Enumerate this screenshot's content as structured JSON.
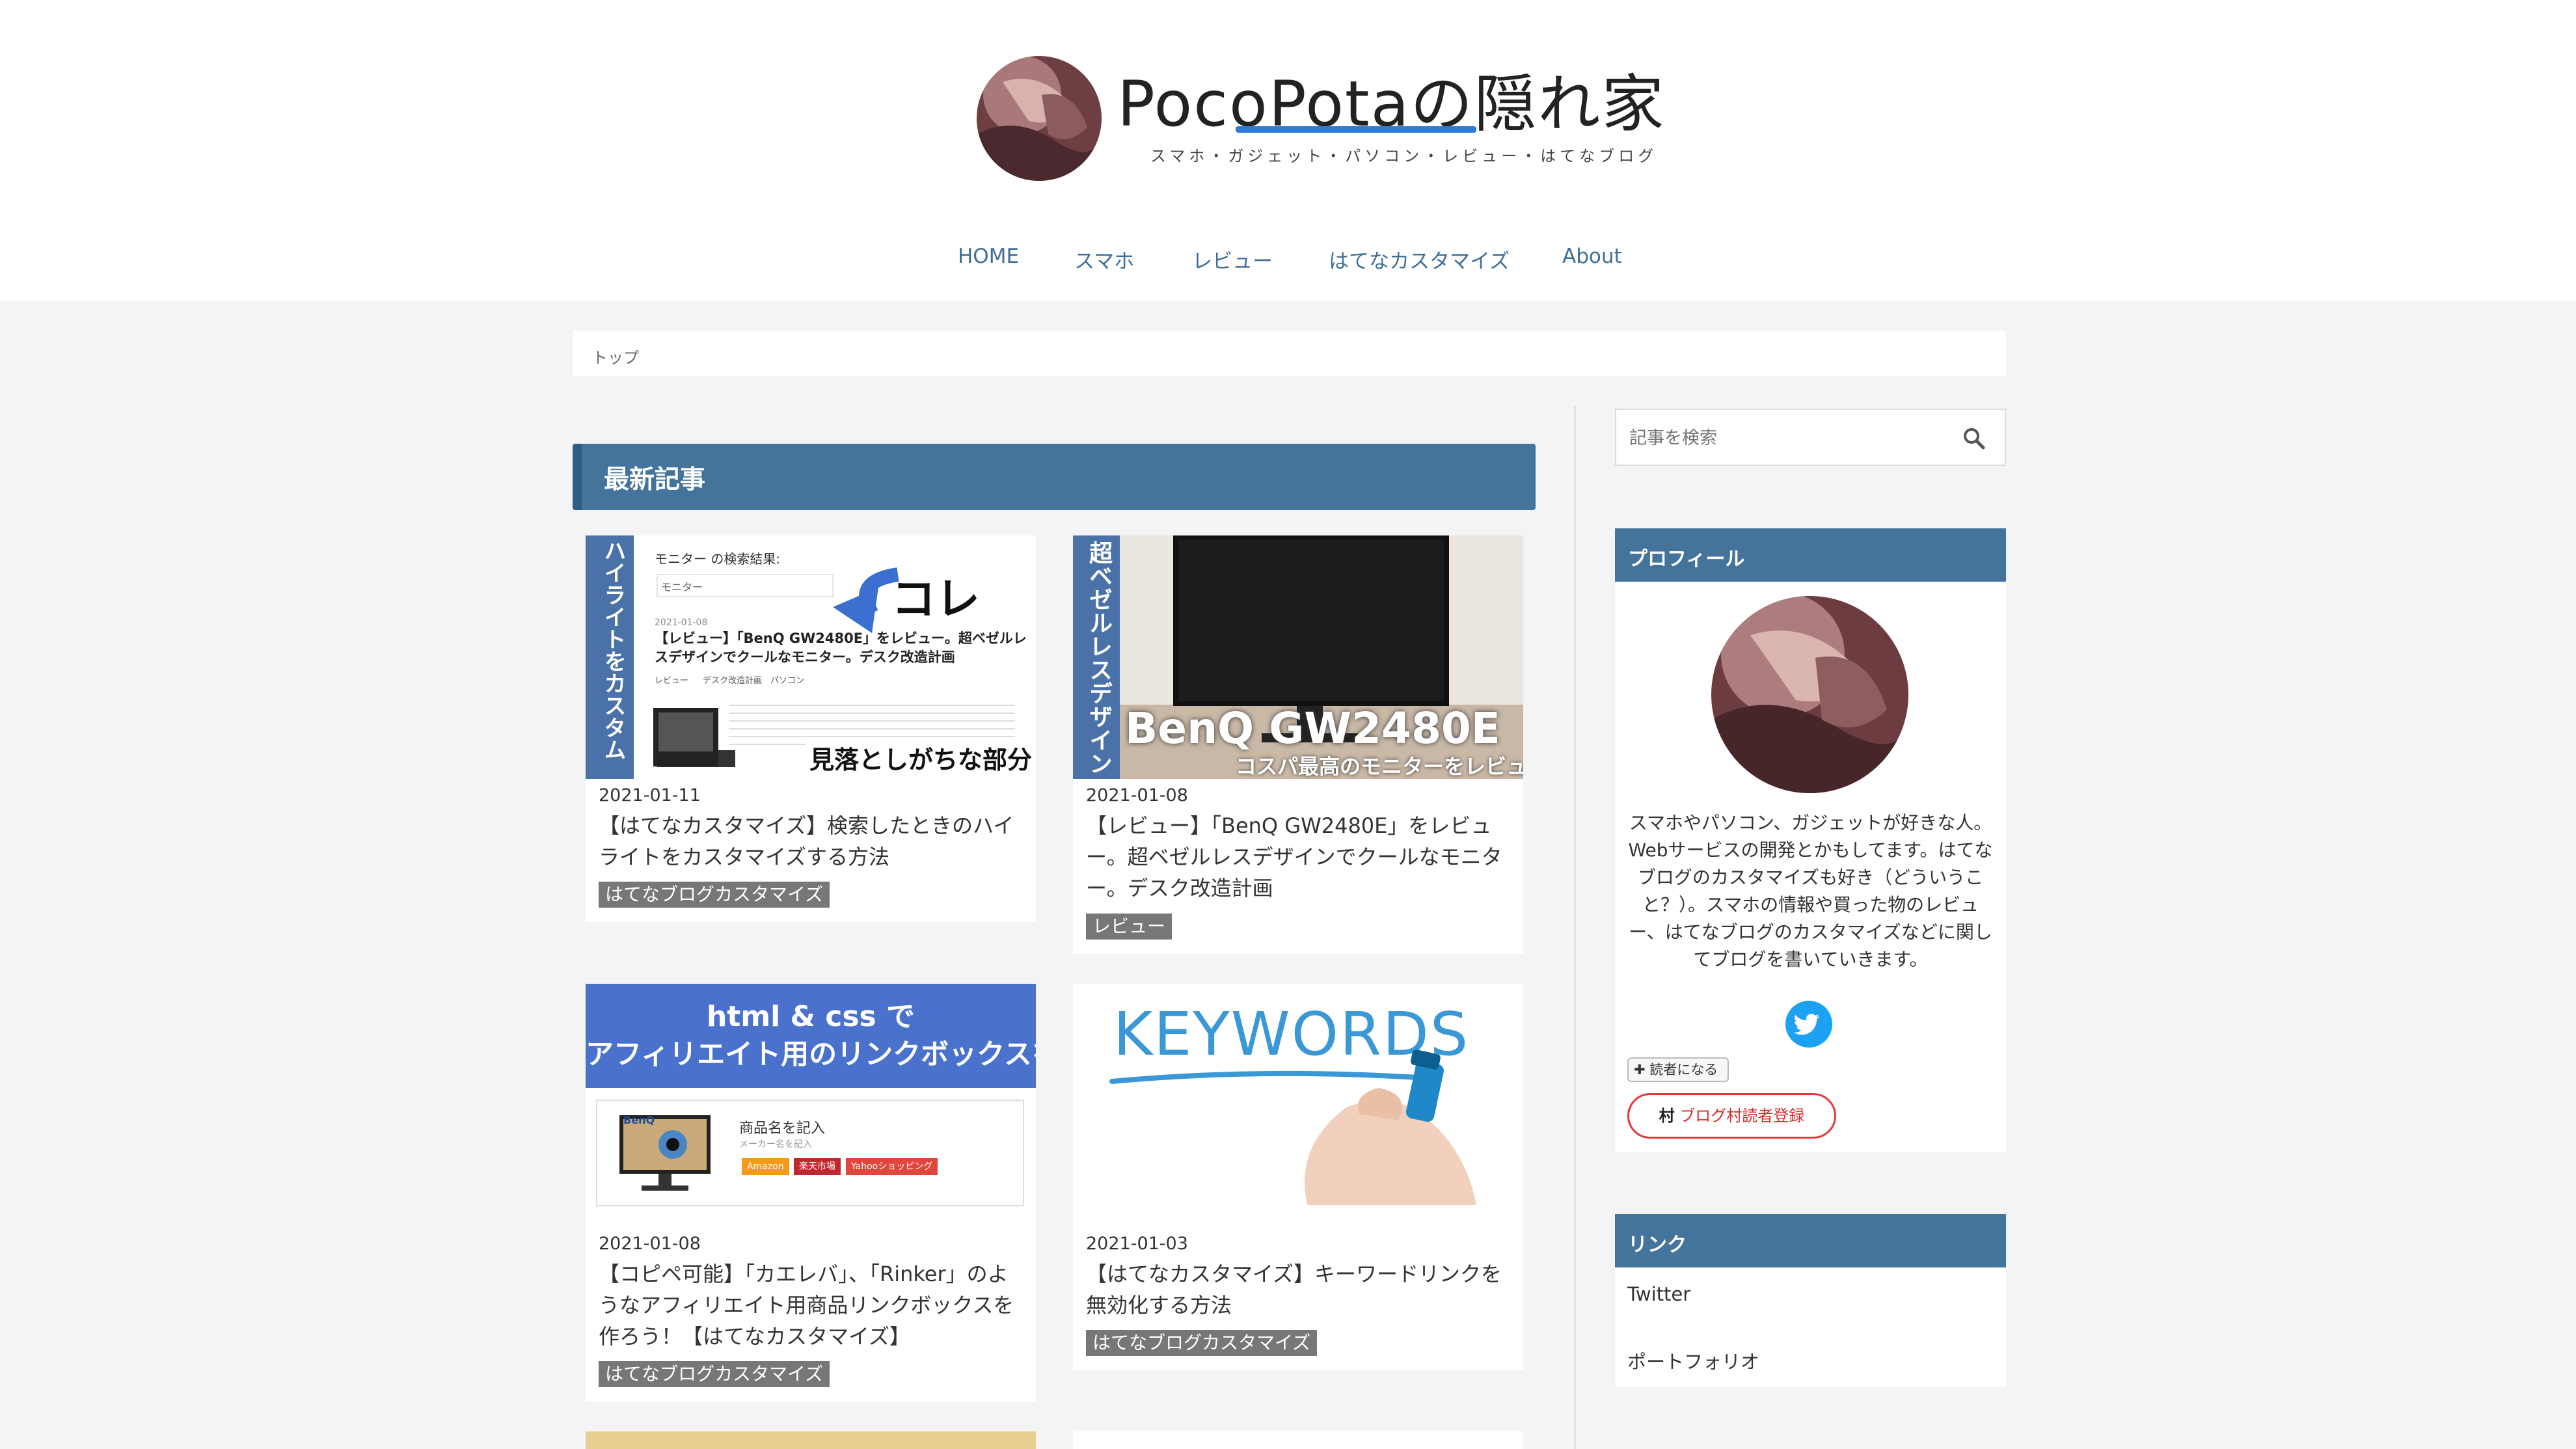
{
  "header": {
    "site_title": "PocoPotaの隠れ家",
    "tagline": "スマホ・ガジェット・パソコン・レビュー・はてなブログ",
    "nav": [
      "HOME",
      "スマホ",
      "レビュー",
      "はてなカスタマイズ",
      "About"
    ]
  },
  "breadcrumb": "トップ",
  "main": {
    "section_title": "最新記事",
    "articles": [
      {
        "date": "2021-01-11",
        "title": "【はてなカスタマイズ】検索したときのハイライトをカスタマイズする方法",
        "category": "はてなブログカスタマイズ",
        "thumb": {
          "side_label": "ハイライトをカスタム",
          "search_heading": "モニター の検索結果:",
          "search_value": "モニター",
          "callout": "コレ",
          "result_date": "2021-01-08",
          "result_title": "【レビュー】「BenQ GW2480E」をレビュー。超ベゼルレスデザインでクールなモニター。デスク改造計画",
          "result_tags": [
            "レビュー",
            "デスク改造計画",
            "パソコン"
          ],
          "caption": "見落としがちな部分"
        }
      },
      {
        "date": "2021-01-08",
        "title": "【レビュー】「BenQ GW2480E」をレビュー。超ベゼルレスデザインでクールなモニター。デスク改造計画",
        "category": "レビュー",
        "thumb": {
          "side_label": "超ベゼルレスデザイン",
          "model": "BenQ GW2480E",
          "subcaption": "コスパ最高のモニターをレビュー"
        }
      },
      {
        "date": "2021-01-08",
        "title": "【コピペ可能】「カエレバ」、「Rinker」のようなアフィリエイト用商品リンクボックスを作ろう！【はてなカスタマイズ】",
        "category": "はてなブログカスタマイズ",
        "thumb": {
          "banner_line1": "html & css で",
          "banner_line2": "アフィリエイト用のリンクボックスを",
          "brand": "BenQ",
          "product_name": "商品名を記入",
          "maker": "メーカー名を記入",
          "shop_buttons": [
            "Amazon",
            "楽天市場",
            "Yahooショッピング"
          ]
        }
      },
      {
        "date": "2021-01-03",
        "title": "【はてなカスタマイズ】キーワードリンクを無効化する方法",
        "category": "はてなブログカスタマイズ",
        "thumb": {
          "word": "KEYWORDS"
        }
      }
    ]
  },
  "sidebar": {
    "search_placeholder": "記事を検索",
    "profile_title": "プロフィール",
    "profile_text": "スマホやパソコン、ガジェットが好きな人。Webサービスの開発とかもしてます。はてなブログのカスタマイズも好き（どういうこと？）。スマホの情報や買った物のレビュー、はてなブログのカスタマイズなどに関してブログを書いていきます。",
    "follow_label": "読者になる",
    "village_label": "ブログ村読者登録",
    "links_title": "リンク",
    "links": [
      "Twitter",
      "ポートフォリオ"
    ]
  },
  "colors": {
    "accent": "#44749b",
    "nav_text": "#3f6f98",
    "category_badge": "#777777",
    "twitter": "#1da1f2",
    "village_red": "#e03a3a",
    "highlight_pink": "#ff4fa3"
  },
  "icons": [
    "search-icon",
    "twitter-icon",
    "plus-icon",
    "village-icon"
  ]
}
